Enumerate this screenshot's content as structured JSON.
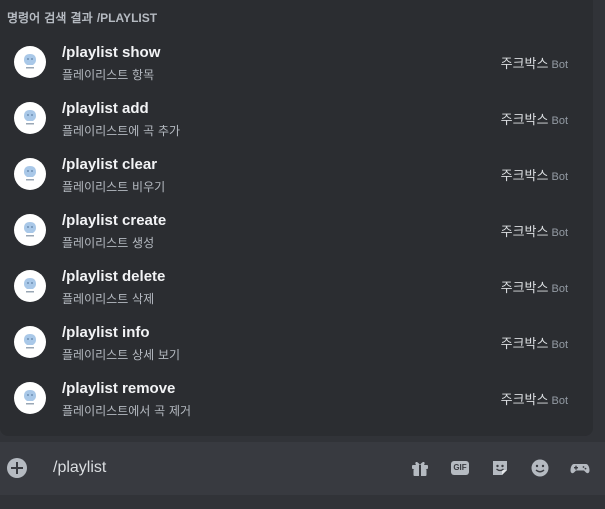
{
  "autocomplete": {
    "header_prefix": "명령어 검색 결과",
    "header_query": "/PLAYLIST",
    "commands": [
      {
        "name": "/playlist show",
        "description": "플레이리스트 항목",
        "source": "주크박스",
        "source_tag": "Bot"
      },
      {
        "name": "/playlist add",
        "description": "플레이리스트에 곡 추가",
        "source": "주크박스",
        "source_tag": "Bot"
      },
      {
        "name": "/playlist clear",
        "description": "플레이리스트 비우기",
        "source": "주크박스",
        "source_tag": "Bot"
      },
      {
        "name": "/playlist create",
        "description": "플레이리스트 생성",
        "source": "주크박스",
        "source_tag": "Bot"
      },
      {
        "name": "/playlist delete",
        "description": "플레이리스트 삭제",
        "source": "주크박스",
        "source_tag": "Bot"
      },
      {
        "name": "/playlist info",
        "description": "플레이리스트 상세 보기",
        "source": "주크박스",
        "source_tag": "Bot"
      },
      {
        "name": "/playlist remove",
        "description": "플레이리스트에서 곡 제거",
        "source": "주크박스",
        "source_tag": "Bot"
      }
    ]
  },
  "chat_bar": {
    "input_value": "/playlist",
    "icons": [
      "add-attachment-icon",
      "gift-icon",
      "gif-icon",
      "sticker-icon",
      "emoji-icon",
      "activities-icon"
    ],
    "gif_label": "GIF"
  },
  "colors": {
    "background": "#313338",
    "popup": "#2b2d31",
    "chat_bar": "#383a40",
    "text_primary": "#f2f3f5",
    "text_muted": "#b5bac1"
  }
}
